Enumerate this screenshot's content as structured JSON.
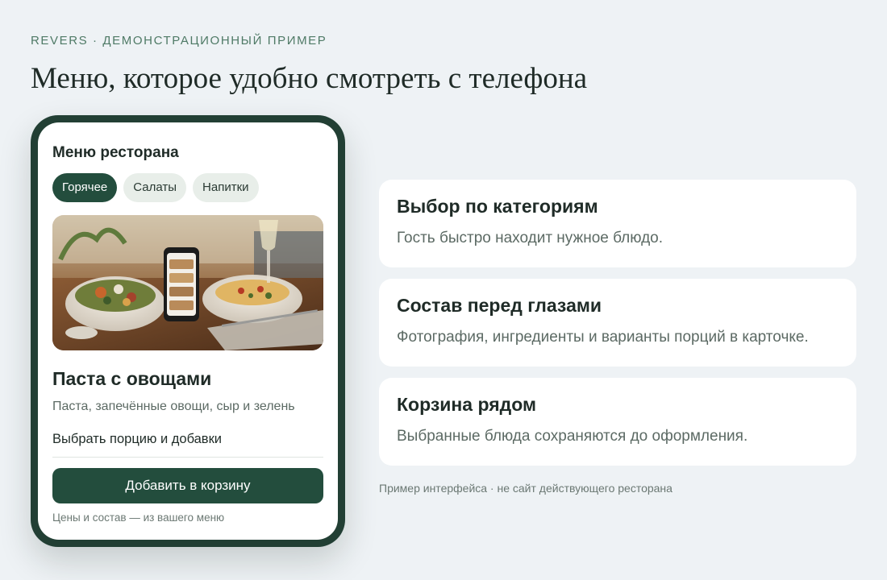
{
  "header": {
    "eyebrow": "REVERS · ДЕМОНСТРАЦИОННЫЙ ПРИМЕР",
    "headline": "Меню, которое удобно смотреть с телефона"
  },
  "phone": {
    "menu_title": "Меню ресторана",
    "categories": [
      {
        "label": "Горячее",
        "active": true
      },
      {
        "label": "Салаты",
        "active": false
      },
      {
        "label": "Напитки",
        "active": false
      }
    ],
    "dish": {
      "name": "Паста с овощами",
      "description": "Паста, запечённые овощи, сыр и зелень",
      "portion_link": "Выбрать порцию и добавки"
    },
    "add_button": "Добавить в корзину",
    "note": "Цены и состав — из вашего меню"
  },
  "features": [
    {
      "title": "Выбор по категориям",
      "text": "Гость быстро находит нужное блюдо."
    },
    {
      "title": "Состав перед глазами",
      "text": "Фотография, ингредиенты и варианты порций в карточке."
    },
    {
      "title": "Корзина рядом",
      "text": "Выбранные блюда сохраняются до оформления."
    }
  ],
  "disclaimer": "Пример интерфейса · не сайт действующего ресторана",
  "colors": {
    "background": "#eef2f5",
    "brand": "#234d3d",
    "phone_frame": "#223f34",
    "chip_inactive": "#e8eee9",
    "eyebrow": "#4f7a66"
  }
}
